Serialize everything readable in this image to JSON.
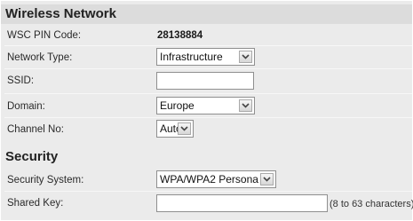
{
  "wireless": {
    "title": "Wireless Network",
    "wsc_pin": {
      "label": "WSC PIN Code:",
      "value": "28138884"
    },
    "network_type": {
      "label": "Network Type:",
      "value": "Infrastructure"
    },
    "ssid": {
      "label": "SSID:",
      "value": ""
    },
    "domain": {
      "label": "Domain:",
      "value": "Europe"
    },
    "channel": {
      "label": "Channel No:",
      "value": "Auto"
    }
  },
  "security": {
    "title": "Security",
    "system": {
      "label": "Security System:",
      "value": "WPA/WPA2 Persona"
    },
    "shared_key": {
      "label": "Shared Key:",
      "value": "",
      "hint": "(8 to 63 characters)"
    }
  },
  "icons": {
    "dropdown": "chevron-down-icon"
  }
}
